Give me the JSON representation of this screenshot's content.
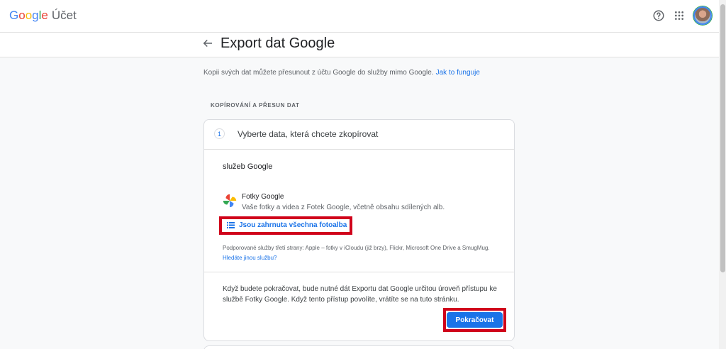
{
  "header": {
    "logo_letters": [
      "G",
      "o",
      "o",
      "g",
      "l",
      "e"
    ],
    "logo_colors": [
      "#4285f4",
      "#ea4335",
      "#fbbc05",
      "#4285f4",
      "#34a853",
      "#ea4335"
    ],
    "product_name": "Účet",
    "icons": [
      "help-icon",
      "apps-grid-icon",
      "account-avatar"
    ]
  },
  "page": {
    "title": "Export dat Google",
    "intro_text": "Kopii svých dat můžete přesunout z účtu Google do služby mimo Google.",
    "intro_link": "Jak to funguje",
    "section_label": "KOPÍROVÁNÍ A PŘESUN DAT"
  },
  "step": {
    "number": "1",
    "title": "Vyberte data, která chcete zkopírovat",
    "services_heading": "služeb Google",
    "service_name": "Fotky Google",
    "service_desc": "Vaše fotky a videa z Fotek Google, včetně obsahu sdílených alb.",
    "albums_link": "Jsou zahrnuta všechna fotoalba",
    "third_party_text": "Podporované služby třetí strany: Apple – fotky v iCloudu (již brzy), Flickr, Microsoft One Drive a SmugMug.",
    "third_party_link": "Hledáte jinou službu?",
    "note": "Když budete pokračovat, bude nutné dát Exportu dat Google určitou úroveň přístupu ke službě Fotky Google. Když tento přístup povolíte, vrátíte se na tuto stránku.",
    "continue_label": "Pokračovat"
  },
  "colors": {
    "accent": "#1a73e8",
    "highlight": "#d0021b"
  }
}
